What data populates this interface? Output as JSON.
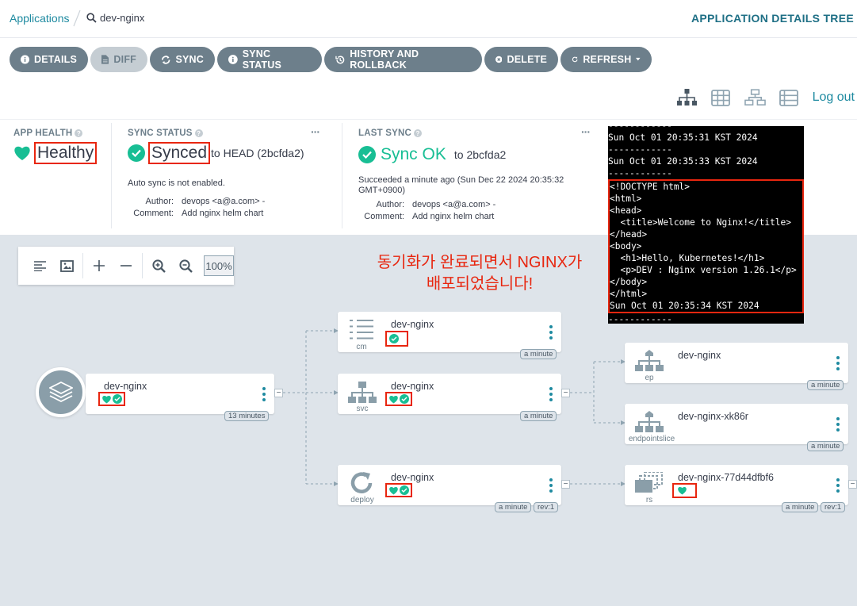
{
  "breadcrumb": {
    "applications": "Applications",
    "current": "dev-nginx"
  },
  "page_heading": "APPLICATION DETAILS TREE",
  "actions": [
    {
      "label": "DETAILS",
      "icon": "info-icon"
    },
    {
      "label": "DIFF",
      "icon": "file-diff-icon",
      "disabled": true
    },
    {
      "label": "SYNC",
      "icon": "sync-icon"
    },
    {
      "label": "SYNC STATUS",
      "icon": "info-icon"
    },
    {
      "label": "HISTORY AND ROLLBACK",
      "icon": "history-icon"
    },
    {
      "label": "DELETE",
      "icon": "delete-icon"
    },
    {
      "label": "REFRESH",
      "icon": "refresh-icon"
    }
  ],
  "view_icons": [
    "tree-view-icon",
    "pods-view-icon",
    "network-view-icon",
    "list-view-icon"
  ],
  "logout": "Log out",
  "app_health": {
    "label": "APP HEALTH",
    "value": "Healthy"
  },
  "sync_status": {
    "label": "SYNC STATUS",
    "value": "Synced",
    "to": "to HEAD (2bcfda2)",
    "auto_sync": "Auto sync is not enabled.",
    "author_key": "Author:",
    "author": "devops <a@a.com> -",
    "comment_key": "Comment:",
    "comment": "Add nginx helm chart",
    "more": "···"
  },
  "last_sync": {
    "label": "LAST SYNC",
    "value": "Sync OK",
    "to": "to 2bcfda2",
    "succeeded": "Succeeded a minute ago (Sun Dec 22 2024 20:35:32 GMT+0900)",
    "author_key": "Author:",
    "author": "devops <a@a.com> -",
    "comment_key": "Comment:",
    "comment": "Add nginx helm chart",
    "more": "···"
  },
  "zoom": {
    "level": "100%"
  },
  "annotation": {
    "line1": "동기화가 완료되면서 NGINX가",
    "line2": "배포되었습니다!"
  },
  "terminal": {
    "lines": [
      "------------",
      "Sun Oct 01 20:35:31 KST 2024",
      "------------",
      "Sun Oct 01 20:35:33 KST 2024",
      "------------",
      "<!DOCTYPE html>",
      "<html>",
      "<head>",
      "  <title>Welcome to Nginx!</title>",
      "</head>",
      "<body>",
      "  <h1>Hello, Kubernetes!</h1>",
      "  <p>DEV : Nginx version 1.26.1</p>",
      "</body>",
      "</html>",
      "Sun Oct 01 20:35:34 KST 2024",
      "------------"
    ]
  },
  "nodes": {
    "app": {
      "name": "dev-nginx",
      "age": "13 minutes"
    },
    "cm": {
      "name": "dev-nginx",
      "kind": "cm",
      "age": "a minute"
    },
    "svc": {
      "name": "dev-nginx",
      "kind": "svc",
      "age": "a minute"
    },
    "deploy": {
      "name": "dev-nginx",
      "kind": "deploy",
      "age": "a minute",
      "rev": "rev:1"
    },
    "ep": {
      "name": "dev-nginx",
      "kind": "ep",
      "age": "a minute"
    },
    "endpointslice": {
      "name": "dev-nginx-xk86r",
      "kind": "endpointslice",
      "age": "a minute"
    },
    "rs": {
      "name": "dev-nginx-77d44dfbf6",
      "kind": "rs",
      "age": "a minute",
      "rev": "rev:1"
    }
  },
  "colors": {
    "accent": "#1e8aa0",
    "healthy": "#18be94",
    "highlight": "#e8260f",
    "button": "#6d7f8b",
    "canvas": "#dee4ea"
  }
}
